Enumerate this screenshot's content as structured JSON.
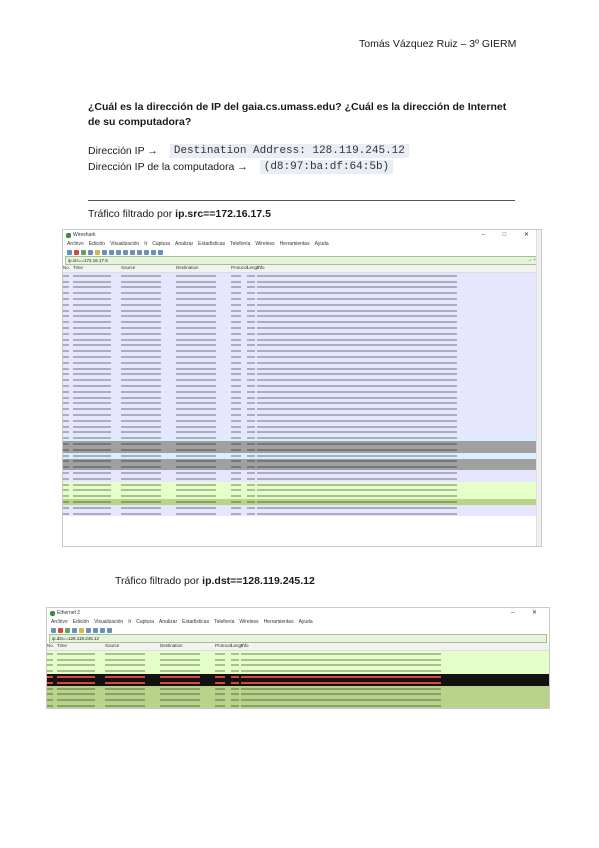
{
  "author": "Tomás Vázquez Ruiz – 3º GIERM",
  "question": "¿Cuál es la dirección de IP del gaia.cs.umass.edu? ¿Cuál es la dirección de Internet de su computadora?",
  "ip_label": "Dirección IP →",
  "ip_value": "Destination Address: 128.119.245.12",
  "pc_label": "Dirección IP de la computadora →",
  "pc_value": "(d8:97:ba:df:64:5b)",
  "section1_prefix": "Tráfico filtrado por ",
  "section1_filter": "ip.src==172.16.17.5",
  "section2_prefix": "Tráfico filtrado por ",
  "section2_filter": "ip.dst==128.119.245.12",
  "ws1": {
    "title": "Wireshark",
    "window_controls": "– □ ✕",
    "menu": [
      "Archivo",
      "Edición",
      "Visualización",
      "Ir",
      "Captura",
      "Analizar",
      "Estadísticas",
      "Telefonía",
      "Wireless",
      "Herramientas",
      "Ayuda"
    ],
    "filter": "ip.src==172.16.17.5",
    "filter_end": "→ +",
    "columns": [
      "No.",
      "Time",
      "Source",
      "Destination",
      "Protocol",
      "Length",
      "Info"
    ]
  },
  "ws2": {
    "title": "Ethernet 2",
    "window_controls": "– ✕",
    "menu": [
      "Archivo",
      "Edición",
      "Visualización",
      "Ir",
      "Captura",
      "Analizar",
      "Estadísticas",
      "Telefonía",
      "Wireless",
      "Herramientas",
      "Ayuda"
    ],
    "filter": "ip.dst==128.119.245.12",
    "columns": [
      "No.",
      "Time",
      "Source",
      "Destination",
      "Protocol",
      "Length",
      "Info"
    ]
  }
}
